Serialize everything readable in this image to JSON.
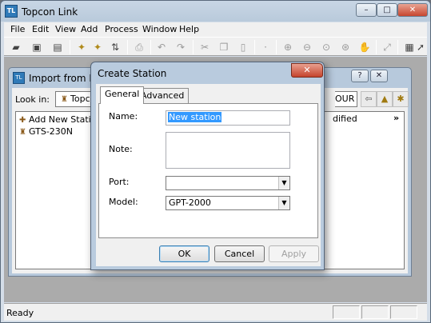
{
  "app": {
    "title": "Topcon Link",
    "icon_text": "TL",
    "min_glyph": "–",
    "max_glyph": "□",
    "close_glyph": "✕"
  },
  "menu": [
    "File",
    "Edit",
    "View",
    "Add",
    "Process",
    "Window",
    "Help"
  ],
  "toolbar": {
    "icons": [
      "open-folder-icon",
      "save-icon",
      "save-all-icon",
      "import-icon",
      "export-icon",
      "transfer-icon",
      "print-icon",
      "undo-icon",
      "redo-icon",
      "cut-icon",
      "copy-icon",
      "paste-icon",
      "point-icon",
      "zoom-in-icon",
      "zoom-out-icon",
      "zoom-window-icon",
      "zoom-extents-icon",
      "pan-icon",
      "fit-icon",
      "grid-icon",
      "select-arrow-icon"
    ]
  },
  "import_window": {
    "title": "Import from Devic",
    "lookin_label": "Look in:",
    "lookin_value": "Topcon",
    "lookin_right": "OUR",
    "items": [
      "Add New Station",
      "GTS-230N"
    ],
    "col_modified": "dified",
    "col_more": "»"
  },
  "dialog": {
    "title": "Create Station",
    "close_glyph": "✕",
    "tabs": [
      "General",
      "Advanced"
    ],
    "name_label": "Name:",
    "name_value": "New station",
    "note_label": "Note:",
    "port_label": "Port:",
    "port_value": "",
    "model_label": "Model:",
    "model_value": "GPT-2000",
    "ok": "OK",
    "cancel": "Cancel",
    "apply": "Apply"
  },
  "status": {
    "text": "Ready"
  }
}
